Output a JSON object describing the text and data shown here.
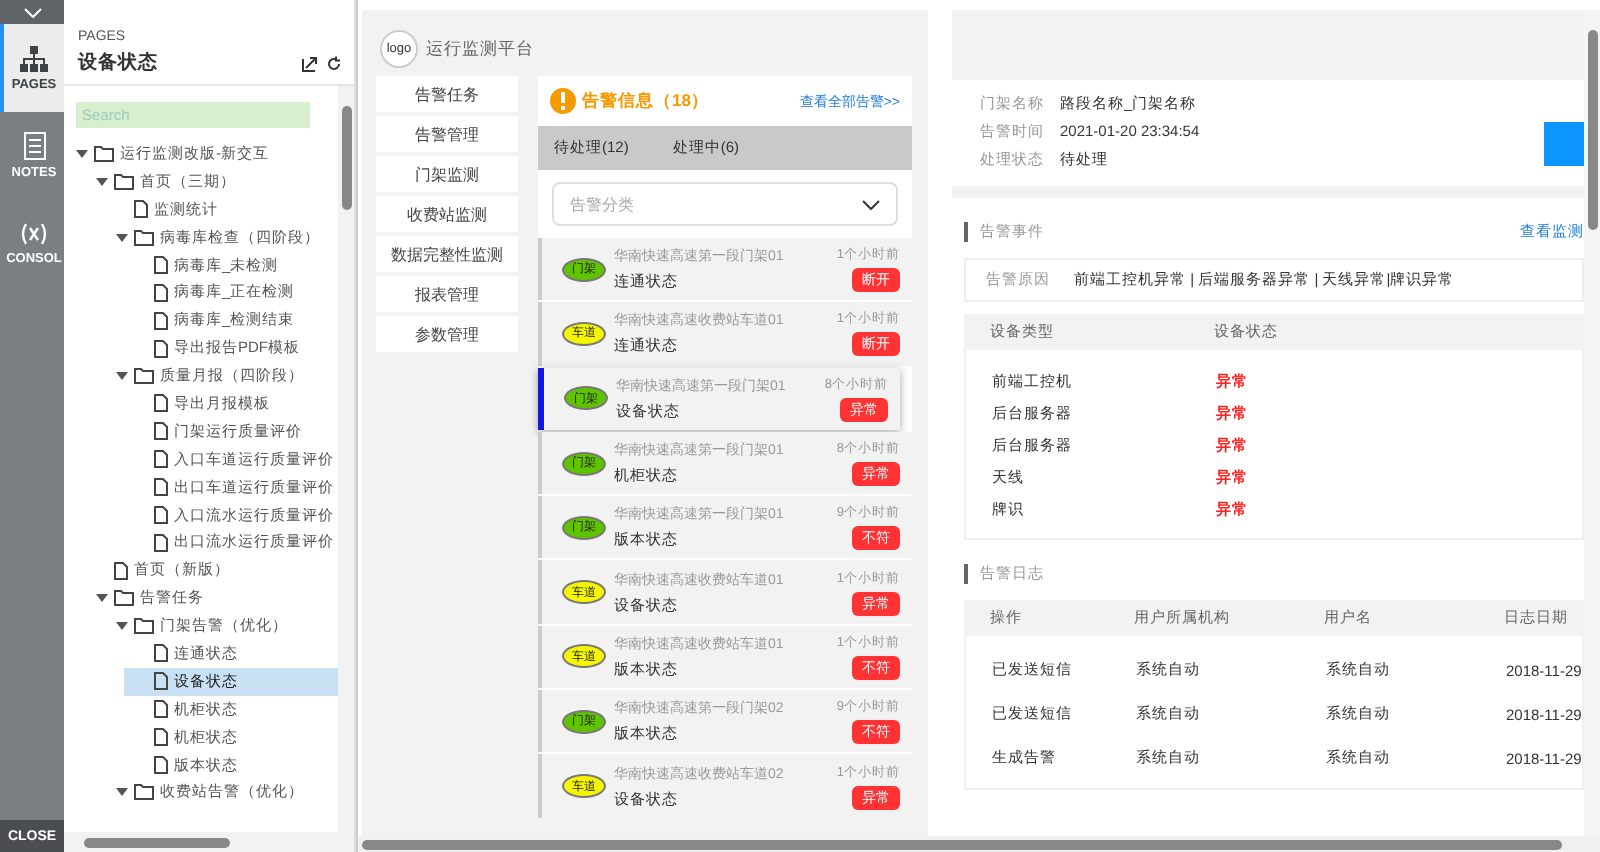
{
  "rail": {
    "tabs": [
      {
        "label": "PAGES",
        "kind": "pages",
        "selected": true
      },
      {
        "label": "NOTES",
        "kind": "notes",
        "selected": false
      },
      {
        "label": "CONSOL",
        "kind": "console",
        "selected": false
      }
    ],
    "close": "CLOSE"
  },
  "pages_panel": {
    "heading": "PAGES",
    "title": "设备状态",
    "search": {
      "placeholder": "Search"
    },
    "tree": [
      {
        "label": "运行监测改版-新交互",
        "kind": "folder",
        "expanded": true,
        "selected": false,
        "children": [
          {
            "label": "首页（三期）",
            "kind": "folder",
            "expanded": true,
            "selected": false,
            "children": [
              {
                "label": "监测统计",
                "kind": "page",
                "selected": false
              },
              {
                "label": "病毒库检查（四阶段）",
                "kind": "folder",
                "expanded": true,
                "selected": false,
                "children": [
                  {
                    "label": "病毒库_未检测",
                    "kind": "page",
                    "selected": false
                  },
                  {
                    "label": "病毒库_正在检测",
                    "kind": "page",
                    "selected": false
                  },
                  {
                    "label": "病毒库_检测结束",
                    "kind": "page",
                    "selected": false
                  },
                  {
                    "label": "导出报告PDF模板",
                    "kind": "page",
                    "selected": false
                  }
                ]
              },
              {
                "label": "质量月报（四阶段）",
                "kind": "folder",
                "expanded": true,
                "selected": false,
                "children": [
                  {
                    "label": "导出月报模板",
                    "kind": "page",
                    "selected": false
                  },
                  {
                    "label": "门架运行质量评价",
                    "kind": "page",
                    "selected": false
                  },
                  {
                    "label": "入口车道运行质量评价",
                    "kind": "page",
                    "selected": false
                  },
                  {
                    "label": "出口车道运行质量评价",
                    "kind": "page",
                    "selected": false
                  },
                  {
                    "label": "入口流水运行质量评价",
                    "kind": "page",
                    "selected": false
                  },
                  {
                    "label": "出口流水运行质量评价",
                    "kind": "page",
                    "selected": false
                  }
                ]
              }
            ]
          },
          {
            "label": "首页（新版）",
            "kind": "page",
            "selected": false
          },
          {
            "label": "告警任务",
            "kind": "folder",
            "expanded": true,
            "selected": false,
            "children": [
              {
                "label": "门架告警（优化）",
                "kind": "folder",
                "expanded": true,
                "selected": false,
                "children": [
                  {
                    "label": "连通状态",
                    "kind": "page",
                    "selected": false
                  },
                  {
                    "label": "设备状态",
                    "kind": "page",
                    "selected": true
                  },
                  {
                    "label": "机柜状态",
                    "kind": "page",
                    "selected": false
                  },
                  {
                    "label": "机柜状态",
                    "kind": "page",
                    "selected": false
                  },
                  {
                    "label": "版本状态",
                    "kind": "page",
                    "selected": false
                  }
                ]
              },
              {
                "label": "收费站告警（优化）",
                "kind": "folder",
                "expanded": true,
                "selected": false
              }
            ]
          }
        ]
      }
    ]
  },
  "app": {
    "logo": "logo",
    "title": "运行监测平台",
    "nav": [
      "告警任务",
      "告警管理",
      "门架监测",
      "收费站监测",
      "数据完整性监测",
      "报表管理",
      "参数管理"
    ],
    "alerts": {
      "title": "告警信息（18）",
      "link": "查看全部告警>>",
      "tabs": [
        "待处理(12)",
        "处理中(6)"
      ],
      "filter": {
        "placeholder": "告警分类"
      },
      "items": [
        {
          "kind": "gantry",
          "tag": "门架",
          "title": "华南快速高速第一段门架01",
          "subtitle": "连通状态",
          "time": "1个小时前",
          "status": "断开",
          "selected": false
        },
        {
          "kind": "lane",
          "tag": "车道",
          "title": "华南快速高速收费站车道01",
          "subtitle": "连通状态",
          "time": "1个小时前",
          "status": "断开",
          "selected": false
        },
        {
          "kind": "gantry",
          "tag": "门架",
          "title": "华南快速高速第一段门架01",
          "subtitle": "设备状态",
          "time": "8个小时前",
          "status": "异常",
          "selected": true
        },
        {
          "kind": "gantry",
          "tag": "门架",
          "title": "华南快速高速第一段门架01",
          "subtitle": "机柜状态",
          "time": "8个小时前",
          "status": "异常",
          "selected": false
        },
        {
          "kind": "gantry",
          "tag": "门架",
          "title": "华南快速高速第一段门架01",
          "subtitle": "版本状态",
          "time": "9个小时前",
          "status": "不符",
          "selected": false
        },
        {
          "kind": "lane",
          "tag": "车道",
          "title": "华南快速高速收费站车道01",
          "subtitle": "设备状态",
          "time": "1个小时前",
          "status": "异常",
          "selected": false
        },
        {
          "kind": "lane",
          "tag": "车道",
          "title": "华南快速高速收费站车道01",
          "subtitle": "版本状态",
          "time": "1个小时前",
          "status": "不符",
          "selected": false
        },
        {
          "kind": "gantry",
          "tag": "门架",
          "title": "华南快速高速第一段门架02",
          "subtitle": "版本状态",
          "time": "9个小时前",
          "status": "不符",
          "selected": false
        },
        {
          "kind": "lane",
          "tag": "车道",
          "title": "华南快速高速收费站车道02",
          "subtitle": "设备状态",
          "time": "1个小时前",
          "status": "异常",
          "selected": false
        }
      ]
    }
  },
  "detail": {
    "info": [
      {
        "label": "门架名称",
        "value": "路段名称_门架名称"
      },
      {
        "label": "告警时间",
        "value": "2021-01-20 23:34:54"
      },
      {
        "label": "处理状态",
        "value": "待处理"
      }
    ],
    "events": {
      "title": "告警事件",
      "link": "查看监测",
      "reason_label": "告警原因",
      "reason": "前端工控机异常 | 后端服务器异常 | 天线异常|牌识异常",
      "columns": [
        "设备类型",
        "设备状态"
      ],
      "rows": [
        [
          "前端工控机",
          "异常"
        ],
        [
          "后台服务器",
          "异常"
        ],
        [
          "后台服务器",
          "异常"
        ],
        [
          "天线",
          "异常"
        ],
        [
          "牌识",
          "异常"
        ]
      ]
    },
    "log": {
      "title": "告警日志",
      "columns": [
        "操作",
        "用户所属机构",
        "用户名",
        "日志日期"
      ],
      "rows": [
        [
          "已发送短信",
          "系统自动",
          "系统自动",
          "2018-11-29"
        ],
        [
          "已发送短信",
          "系统自动",
          "系统自动",
          "2018-11-29"
        ],
        [
          "生成告警",
          "系统自动",
          "系统自动",
          "2018-11-29"
        ]
      ]
    }
  }
}
